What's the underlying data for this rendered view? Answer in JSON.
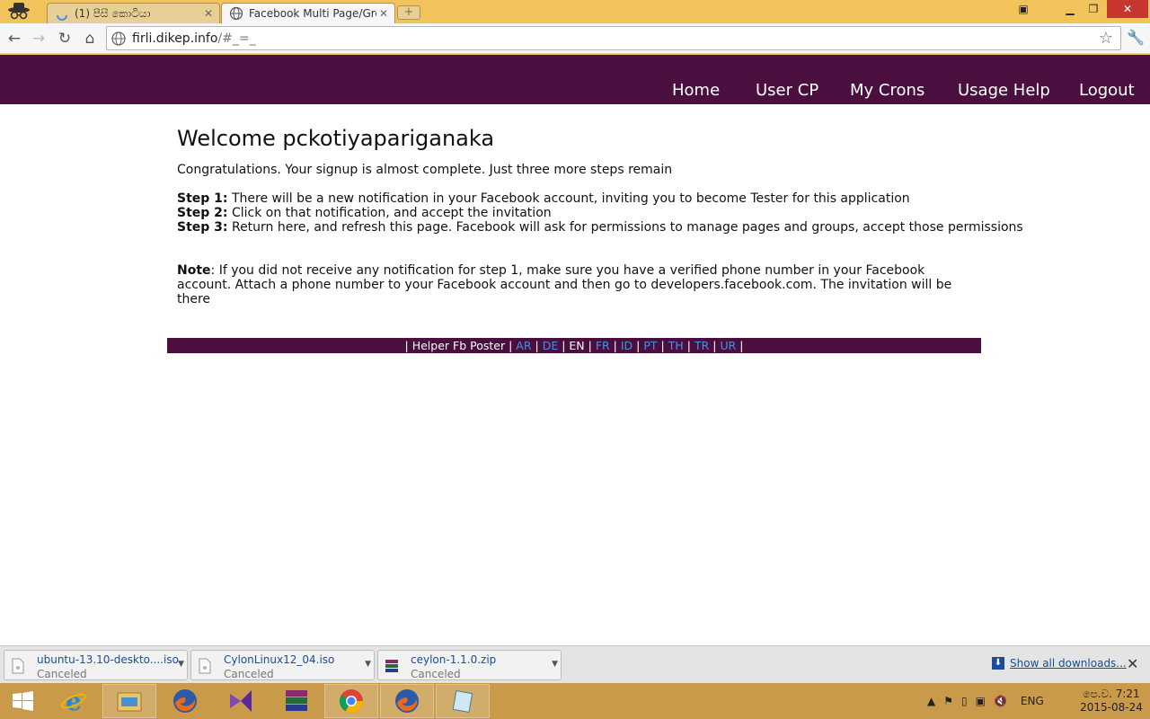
{
  "browser": {
    "tabs": [
      {
        "title": "(1) පීසී කොටියා",
        "active": false
      },
      {
        "title": "Facebook Multi Page/Group",
        "active": true
      }
    ],
    "url_host": "firli.dikep.info",
    "url_path": "/#_=_"
  },
  "site_nav": {
    "items": [
      "Home",
      "User CP",
      "My Crons",
      "Usage Help",
      "Logout"
    ]
  },
  "content": {
    "heading": "Welcome pckotiyapariganaka",
    "intro": "Congratulations. Your signup is almost complete. Just three more steps remain",
    "steps": [
      {
        "label": "Step 1:",
        "text": " There will be a new notification in your Facebook account, inviting you to become Tester for this application"
      },
      {
        "label": "Step 2:",
        "text": " Click on that notification, and accept the invitation"
      },
      {
        "label": "Step 3:",
        "text": " Return here, and refresh this page. Facebook will ask for permissions to manage pages and groups, accept those permissions"
      }
    ],
    "note_label": "Note",
    "note_text": ": If you did not receive any notification for step 1, make sure you have a verified phone number in your Facebook account. Attach a phone number to your Facebook account and then go to developers.facebook.com. The invitation will be there"
  },
  "footer": {
    "site_name": "Helper Fb Poster",
    "languages": [
      "AR",
      "DE",
      "EN",
      "FR",
      "ID",
      "PT",
      "TH",
      "TR",
      "UR"
    ],
    "current_language": "EN"
  },
  "downloads": {
    "items": [
      {
        "name": "ubuntu-13.10-deskto....iso",
        "status": "Canceled"
      },
      {
        "name": "CylonLinux12_04.iso",
        "status": "Canceled"
      },
      {
        "name": "ceylon-1.1.0.zip",
        "status": "Canceled"
      }
    ],
    "show_all": "Show all downloads..."
  },
  "taskbar": {
    "apps": [
      "internet-explorer-icon",
      "file-explorer-icon",
      "firefox-icon",
      "visual-studio-icon",
      "winrar-icon",
      "chrome-icon",
      "firefox-icon",
      "notepad-icon"
    ],
    "language": "ENG",
    "time": "පෙ.ව. 7:21",
    "date": "2015-08-24"
  },
  "colors": {
    "nav_bg": "#4a0f3f",
    "link": "#4a8fe0",
    "taskbar": "#c89a4a",
    "titlebar": "#f2c35b"
  }
}
